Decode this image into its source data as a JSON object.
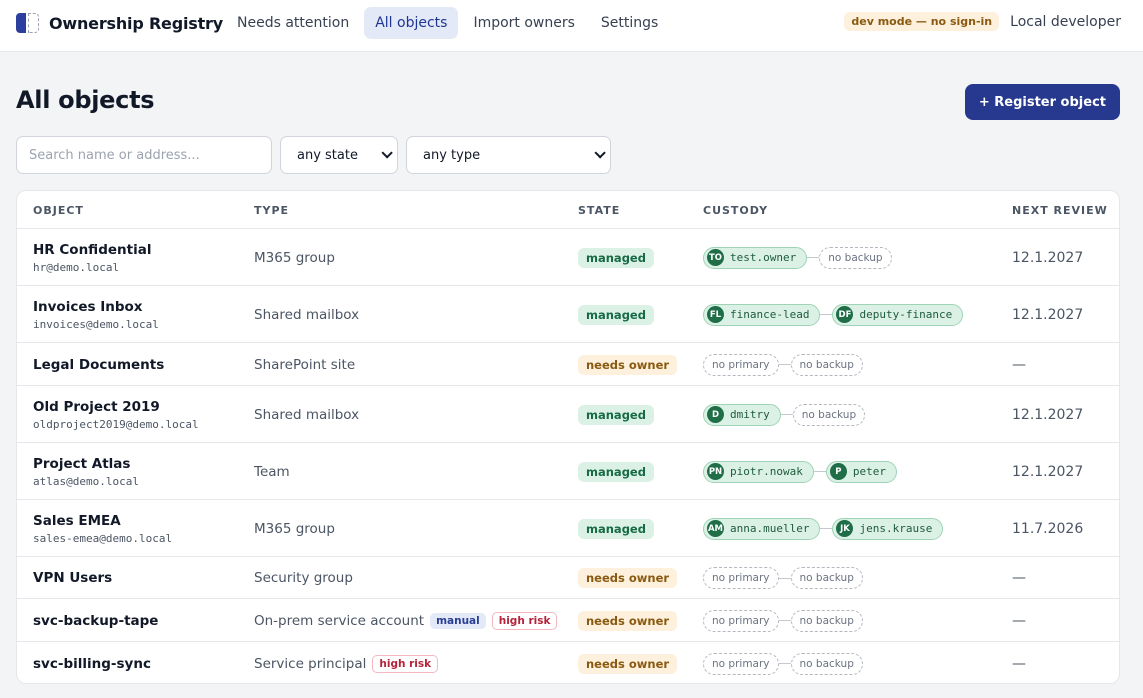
{
  "app": {
    "brand": "Ownership Registry",
    "dev_mode_badge": "dev mode — no sign-in",
    "user_name": "Local developer",
    "nav": [
      {
        "label": "Needs attention",
        "active": false
      },
      {
        "label": "All objects",
        "active": true
      },
      {
        "label": "Import owners",
        "active": false
      },
      {
        "label": "Settings",
        "active": false
      }
    ]
  },
  "page": {
    "title": "All objects",
    "register_label": "+ Register object"
  },
  "filters": {
    "search_placeholder": "Search name or address...",
    "state_value": "any state",
    "type_value": "any type"
  },
  "table": {
    "columns": [
      "OBJECT",
      "TYPE",
      "STATE",
      "CUSTODY",
      "NEXT REVIEW"
    ],
    "rows": [
      {
        "name": "HR Confidential",
        "address": "hr@demo.local",
        "type": "M365 group",
        "tags": [],
        "state": "managed",
        "primary": {
          "initials": "TO",
          "name": "test.owner"
        },
        "backup": null,
        "next_review": "12.1.2027"
      },
      {
        "name": "Invoices Inbox",
        "address": "invoices@demo.local",
        "type": "Shared mailbox",
        "tags": [],
        "state": "managed",
        "primary": {
          "initials": "FL",
          "name": "finance-lead"
        },
        "backup": {
          "initials": "DF",
          "name": "deputy-finance"
        },
        "next_review": "12.1.2027"
      },
      {
        "name": "Legal Documents",
        "address": "",
        "type": "SharePoint site",
        "tags": [],
        "state": "needs owner",
        "primary": null,
        "backup": null,
        "next_review": "—"
      },
      {
        "name": "Old Project 2019",
        "address": "oldproject2019@demo.local",
        "type": "Shared mailbox",
        "tags": [],
        "state": "managed",
        "primary": {
          "initials": "D",
          "name": "dmitry"
        },
        "backup": null,
        "next_review": "12.1.2027"
      },
      {
        "name": "Project Atlas",
        "address": "atlas@demo.local",
        "type": "Team",
        "tags": [],
        "state": "managed",
        "primary": {
          "initials": "PN",
          "name": "piotr.nowak"
        },
        "backup": {
          "initials": "P",
          "name": "peter"
        },
        "next_review": "12.1.2027"
      },
      {
        "name": "Sales EMEA",
        "address": "sales-emea@demo.local",
        "type": "M365 group",
        "tags": [],
        "state": "managed",
        "primary": {
          "initials": "AM",
          "name": "anna.mueller"
        },
        "backup": {
          "initials": "JK",
          "name": "jens.krause"
        },
        "next_review": "11.7.2026"
      },
      {
        "name": "VPN Users",
        "address": "",
        "type": "Security group",
        "tags": [],
        "state": "needs owner",
        "primary": null,
        "backup": null,
        "next_review": "—"
      },
      {
        "name": "svc-backup-tape",
        "address": "",
        "type": "On-prem service account",
        "tags": [
          {
            "label": "manual",
            "kind": "manual"
          },
          {
            "label": "high risk",
            "kind": "risk"
          }
        ],
        "state": "needs owner",
        "primary": null,
        "backup": null,
        "next_review": "—"
      },
      {
        "name": "svc-billing-sync",
        "address": "",
        "type": "Service principal",
        "tags": [
          {
            "label": "high risk",
            "kind": "risk"
          }
        ],
        "state": "needs owner",
        "primary": null,
        "backup": null,
        "next_review": "—"
      }
    ],
    "empty_primary_label": "no primary",
    "empty_backup_label": "no backup"
  }
}
